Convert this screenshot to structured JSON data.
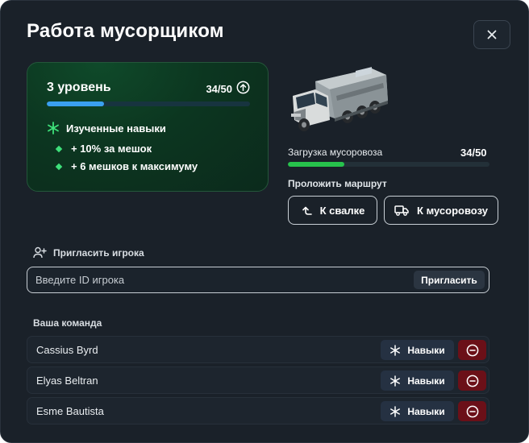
{
  "window": {
    "title": "Работа мусорщиком"
  },
  "level_card": {
    "level_label": "3 уровень",
    "progress_text": "34/50",
    "progress_fraction": 0.28,
    "skills_title": "Изученные навыки",
    "skills": [
      "+ 10% за мешок",
      "+ 6 мешков к максимуму"
    ]
  },
  "truck": {
    "load_label": "Загрузка мусоровоза",
    "load_text": "34/50",
    "load_fraction": 0.28
  },
  "route": {
    "label": "Проложить маршрут",
    "dump_button": "К свалке",
    "truck_button": "К мусоровозу"
  },
  "invite": {
    "title": "Пригласить игрока",
    "placeholder": "Введите ID игрока",
    "value": "",
    "button": "Пригласить"
  },
  "team": {
    "title": "Ваша команда",
    "skills_button": "Навыки",
    "members": [
      {
        "name": "Cassius Byrd"
      },
      {
        "name": "Elyas Beltran"
      },
      {
        "name": "Esme Bautista"
      }
    ]
  },
  "colors": {
    "background": "#1a2129",
    "level_accent": "#3aa0f0",
    "load_accent": "#27c24c",
    "skill_green": "#3ee07a",
    "remove_red": "#6b1018"
  },
  "icons": {
    "close": "close-icon",
    "level_up": "arrow-up-circle-icon",
    "skills": "star-icon",
    "dump": "turn-up-arrow-icon",
    "truck": "truck-icon",
    "invite": "user-plus-icon",
    "member_skills": "asterisk-icon",
    "remove": "minus-circle-icon"
  }
}
